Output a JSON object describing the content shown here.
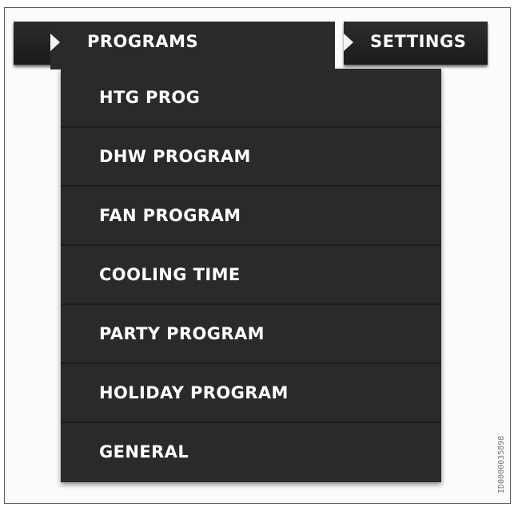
{
  "tabs": {
    "programs_label": "PROGRAMS",
    "settings_label": "SETTINGS"
  },
  "menu": {
    "items": [
      {
        "label": "HTG PROG"
      },
      {
        "label": "DHW PROGRAM"
      },
      {
        "label": "FAN PROGRAM"
      },
      {
        "label": "COOLING TIME"
      },
      {
        "label": "PARTY PROGRAM"
      },
      {
        "label": "HOLIDAY PROGRAM"
      },
      {
        "label": "GENERAL"
      }
    ]
  },
  "image_id": "ID0000035898",
  "colors": {
    "bar": "#2a2a2a",
    "text": "#ffffff",
    "background": "#ffffff"
  }
}
